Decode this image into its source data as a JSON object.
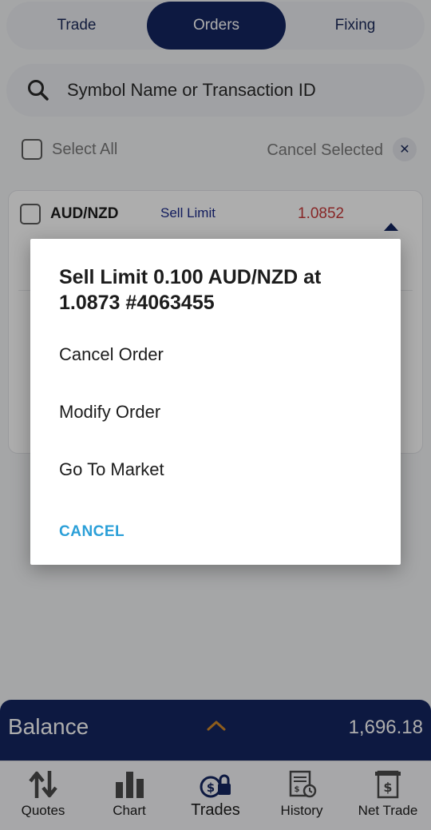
{
  "tabs": [
    {
      "label": "Trade"
    },
    {
      "label": "Orders"
    },
    {
      "label": "Fixing"
    }
  ],
  "search": {
    "placeholder": "Symbol Name or Transaction ID"
  },
  "selection": {
    "select_all_label": "Select All",
    "cancel_selected_label": "Cancel Selected"
  },
  "order": {
    "symbol": "AUD/NZD",
    "type": "Sell Limit",
    "price": "1.0852"
  },
  "dialog": {
    "title": "Sell Limit 0.100 AUD/NZD at 1.0873 #4063455",
    "items": [
      "Cancel Order",
      "Modify Order",
      "Go To Market"
    ],
    "cancel_label": "CANCEL"
  },
  "balance": {
    "label": "Balance",
    "value": "1,696.18"
  },
  "nav": [
    {
      "label": "Quotes",
      "icon": "quotes-icon"
    },
    {
      "label": "Chart",
      "icon": "chart-icon"
    },
    {
      "label": "Trades",
      "icon": "trades-icon"
    },
    {
      "label": "History",
      "icon": "history-icon"
    },
    {
      "label": "Net Trade",
      "icon": "net-trade-icon"
    }
  ],
  "colors": {
    "primary": "#142660",
    "sell_price": "#c83a3a",
    "dialog_cancel": "#2a9fd8"
  }
}
